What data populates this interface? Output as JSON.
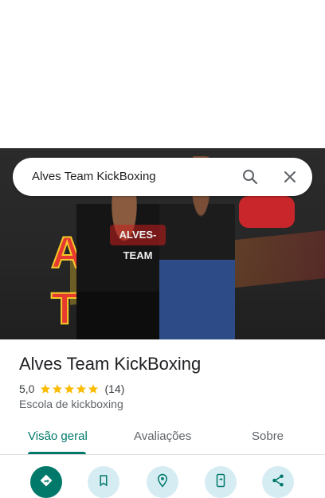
{
  "search": {
    "query": "Alves Team KickBoxing"
  },
  "hero": {
    "wall_sign": "ALVES TEAM",
    "shirt_print": "ALVES-TEAM"
  },
  "place": {
    "name": "Alves Team KickBoxing",
    "rating": "5,0",
    "stars": 5,
    "review_count": "(14)",
    "category": "Escola de kickboxing"
  },
  "tabs": [
    {
      "label": "Visão geral",
      "active": true
    },
    {
      "label": "Avaliações",
      "active": false
    },
    {
      "label": "Sobre",
      "active": false
    }
  ],
  "actions": [
    {
      "icon": "directions-icon"
    },
    {
      "icon": "bookmark-icon"
    },
    {
      "icon": "nearby-icon"
    },
    {
      "icon": "send-to-phone-icon"
    },
    {
      "icon": "share-icon"
    }
  ],
  "colors": {
    "accent": "#00796b",
    "star": "#fbbc04",
    "action_bg": "#d6ecf3"
  }
}
